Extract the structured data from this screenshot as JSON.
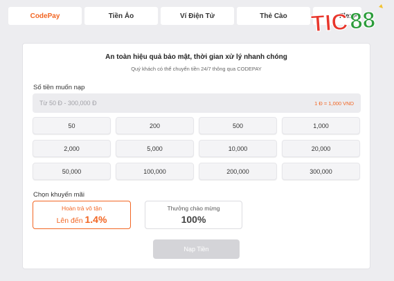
{
  "tabs": [
    {
      "label": "CodePay",
      "active": true
    },
    {
      "label": "Tiền Ảo",
      "active": false
    },
    {
      "label": "Ví Điện Tử",
      "active": false
    },
    {
      "label": "Thẻ Cào",
      "active": false
    },
    {
      "label": "FlexPay",
      "active": false
    }
  ],
  "logo": {
    "text": "TIC88",
    "colors": {
      "tic": "#e8362c",
      "num": "#2c9c3b"
    }
  },
  "panel": {
    "headline": "An toàn hiệu quả bảo mật, thời gian xử lý nhanh chóng",
    "subline": "Quý khách có thể chuyển tiền 24/7 thông qua CODEPAY"
  },
  "amount": {
    "label": "Số tiền muốn nạp",
    "placeholder": "Từ 50 Đ - 300,000 Đ",
    "rate": "1 Đ = 1,000 VND"
  },
  "presets": [
    "50",
    "200",
    "500",
    "1,000",
    "2,000",
    "5,000",
    "10,000",
    "20,000",
    "50,000",
    "100,000",
    "200,000",
    "300,000"
  ],
  "promotions": {
    "label": "Chọn khuyến mãi",
    "items": [
      {
        "title": "Hoàn trả vô tận",
        "prefix": "Lên đến",
        "value": "1.4%",
        "selected": true
      },
      {
        "title": "Thưởng chào mừng",
        "value": "100%",
        "selected": false
      }
    ]
  },
  "submit": {
    "label": "Nạp Tiền",
    "enabled": false
  },
  "colors": {
    "accent": "#f26522",
    "background": "#ededf0",
    "disabled": "#d4d4d8"
  }
}
